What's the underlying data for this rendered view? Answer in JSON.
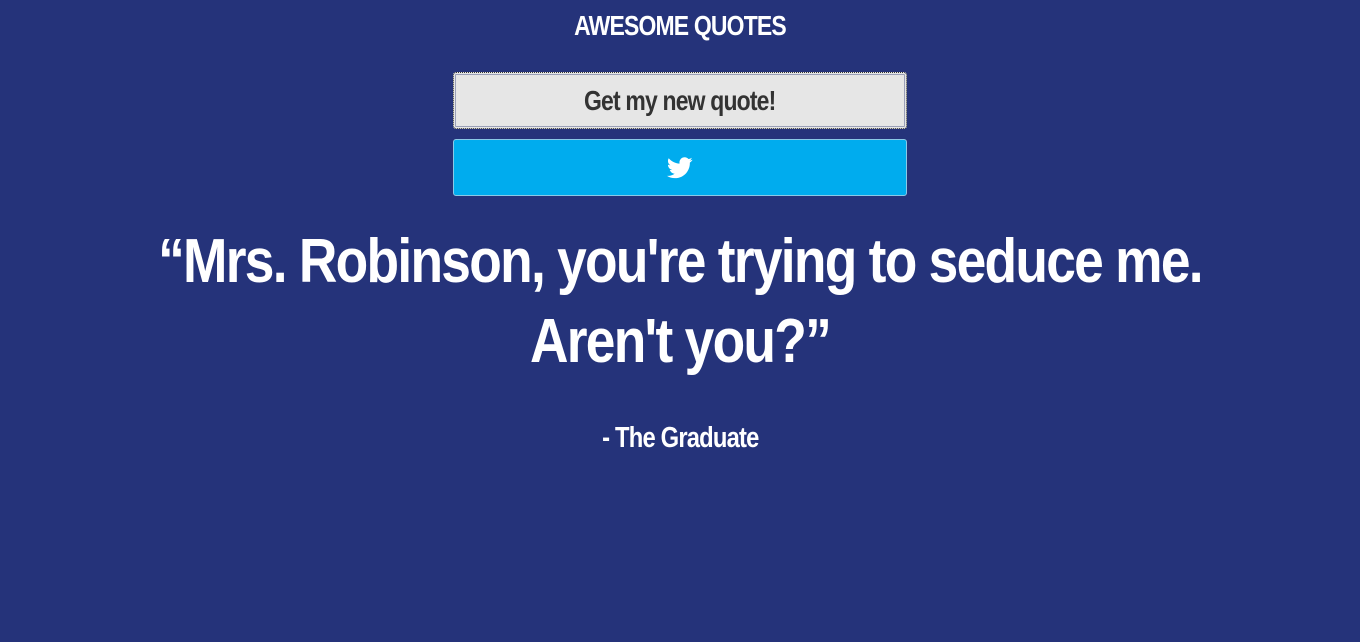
{
  "header": {
    "title": "AWESOME QUOTES"
  },
  "actions": {
    "new_quote_label": "Get my new quote!",
    "tweet_icon": "twitter-bird-icon"
  },
  "quote": {
    "text": "“Mrs. Robinson, you're trying to seduce me. Aren't you?”",
    "author": "- The Graduate"
  },
  "colors": {
    "background": "#25337a",
    "quote_button": "#e6e6e6",
    "tweet_button": "#00acee",
    "text": "#ffffff"
  }
}
